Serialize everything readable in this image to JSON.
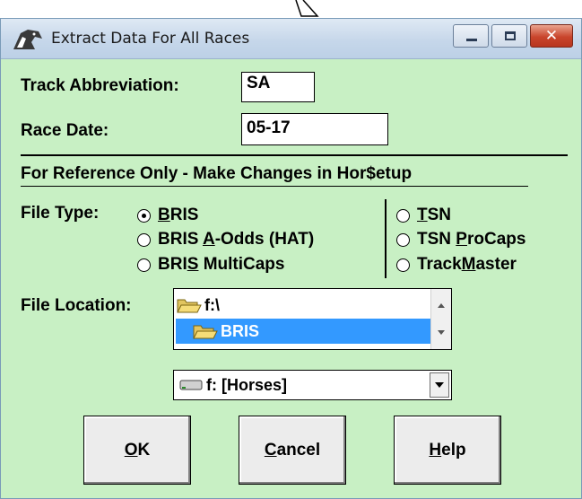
{
  "window": {
    "title": "Extract Data For All Races",
    "app_icon": "horse-head-icon",
    "controls": {
      "minimize": "minimize-icon",
      "maximize": "maximize-icon",
      "close": "✕"
    }
  },
  "form": {
    "track_label": "Track Abbreviation:",
    "track_value": "SA",
    "date_label": "Race Date:",
    "date_value": "05-17",
    "reference_note": "For Reference Only - Make Changes in Hor$etup"
  },
  "file_type": {
    "label": "File Type:",
    "selected": "BRIS",
    "options_left": [
      {
        "pre": "",
        "u": "B",
        "post": "RIS",
        "checked": true
      },
      {
        "pre": "BRIS ",
        "u": "A",
        "post": "-Odds (HAT)",
        "checked": false
      },
      {
        "pre": "BRI",
        "u": "S",
        "post": " MultiCaps",
        "checked": false
      }
    ],
    "options_right": [
      {
        "pre": "",
        "u": "T",
        "post": "SN",
        "checked": false
      },
      {
        "pre": "TSN ",
        "u": "P",
        "post": "roCaps",
        "checked": false
      },
      {
        "pre": "Track",
        "u": "M",
        "post": "aster",
        "checked": false
      }
    ]
  },
  "file_location": {
    "label": "File Location:",
    "folders": [
      {
        "name": "f:\\",
        "selected": false
      },
      {
        "name": "BRIS",
        "selected": true
      }
    ],
    "drive": "f: [Horses]"
  },
  "buttons": [
    {
      "u": "O",
      "post": "K"
    },
    {
      "u": "C",
      "post": "ancel"
    },
    {
      "u": "H",
      "post": "elp"
    }
  ],
  "colors": {
    "dialog_bg": "#c8f0c4",
    "selection": "#3399ff"
  }
}
